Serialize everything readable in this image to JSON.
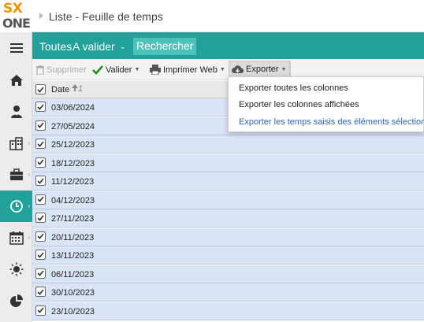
{
  "app": {
    "logo_top": "SX",
    "logo_bottom": "ONE",
    "page_title": "Liste - Feuille de temps",
    "accent_color": "#21a19a"
  },
  "filter_bar": {
    "all_label": "Toutes",
    "status_select": "A valider",
    "search_label": "Rechercher"
  },
  "toolbar": {
    "delete_label": "Supprimer",
    "validate_label": "Valider",
    "print_label": "Imprimer Web",
    "export_label": "Exporter"
  },
  "export_menu": {
    "items": [
      "Exporter toutes les colonnes",
      "Exporter les colonnes affichées",
      "Exporter les temps saisis des éléments sélectionné"
    ]
  },
  "table": {
    "header": "Date",
    "sort_indicator": "1",
    "rows": [
      "03/06/2024",
      "27/05/2024",
      "25/12/2023",
      "18/12/2023",
      "11/12/2023",
      "04/12/2023",
      "27/11/2023",
      "20/11/2023",
      "13/11/2023",
      "06/11/2023",
      "30/10/2023",
      "23/10/2023"
    ]
  },
  "sidebar": {
    "icons": [
      "menu-icon",
      "home-icon",
      "user-icon",
      "building-icon",
      "briefcase-icon",
      "clock-icon",
      "calendar-icon",
      "sun-icon",
      "pie-chart-icon"
    ],
    "active": "clock-icon"
  }
}
